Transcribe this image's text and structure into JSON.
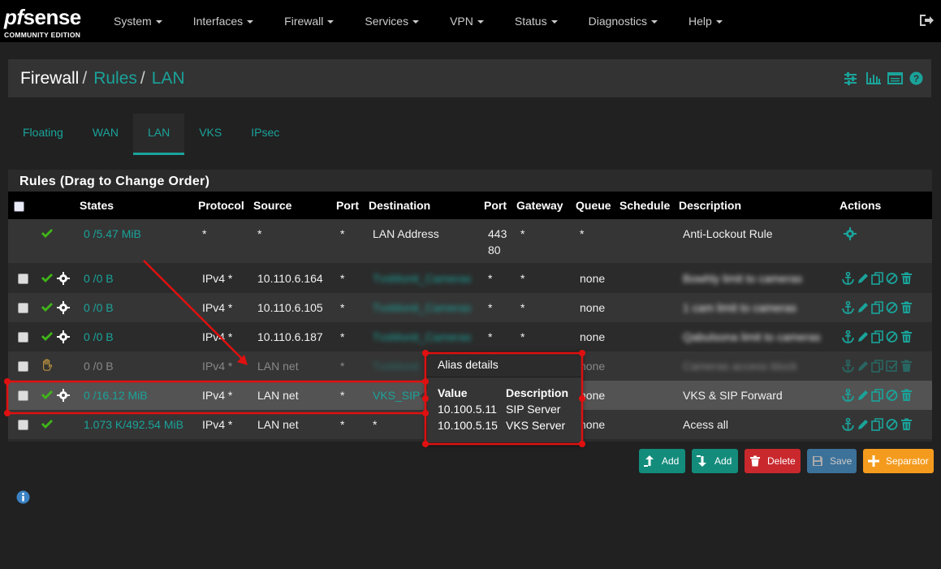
{
  "brand": {
    "name": "sense",
    "prefix": "pf",
    "edition": "COMMUNITY EDITION"
  },
  "nav": {
    "items": [
      "System",
      "Interfaces",
      "Firewall",
      "Services",
      "VPN",
      "Status",
      "Diagnostics",
      "Help"
    ]
  },
  "breadcrumb": {
    "root": "Firewall",
    "level1": "Rules",
    "level2": "LAN"
  },
  "tabs": [
    "Floating",
    "WAN",
    "LAN",
    "VKS",
    "IPsec"
  ],
  "active_tab": "LAN",
  "panel": {
    "title": "Rules (Drag to Change Order)"
  },
  "table": {
    "headers": {
      "states": "States",
      "protocol": "Protocol",
      "source": "Source",
      "port1": "Port",
      "destination": "Destination",
      "port2": "Port",
      "gateway": "Gateway",
      "queue": "Queue",
      "schedule": "Schedule",
      "description": "Description",
      "actions": "Actions"
    },
    "rows": [
      {
        "states": "0 /5.47 MiB",
        "protocol": "*",
        "source": "*",
        "port": "*",
        "destination": "LAN Address",
        "dport1": "443",
        "dport2": "80",
        "gateway": "*",
        "queue": "*",
        "description": "Anti-Lockout Rule"
      },
      {
        "states": "0 /0 B",
        "protocol": "IPv4 *",
        "source": "10.110.6.164",
        "port": "*",
        "destination": "TvsMonit_Cameras",
        "dport": "*",
        "gateway": "*",
        "queue": "none",
        "description": "Bowhly limit to cameras"
      },
      {
        "states": "0 /0 B",
        "protocol": "IPv4 *",
        "source": "10.110.6.105",
        "port": "*",
        "destination": "TvsMonit_Cameras",
        "dport": "*",
        "gateway": "*",
        "queue": "none",
        "description": "1 cam limit to cameras"
      },
      {
        "states": "0 /0 B",
        "protocol": "IPv4 *",
        "source": "10.110.6.187",
        "port": "*",
        "destination": "TvsMonit_Cameras",
        "dport": "*",
        "gateway": "*",
        "queue": "none",
        "description": "Qabulsona limit to cameras"
      },
      {
        "states": "0 /0 B",
        "protocol": "IPv4 *",
        "source": "LAN net",
        "port": "*",
        "destination": "TvsMonit",
        "dport": "",
        "gateway": "",
        "queue": "none",
        "description": "Cameras access block"
      },
      {
        "states": "0 /16.12 MiB",
        "protocol": "IPv4 *",
        "source": "LAN net",
        "port": "*",
        "destination": "VKS_SIP",
        "dport": "",
        "gateway": "",
        "queue": "none",
        "description": "VKS & SIP Forward"
      },
      {
        "states": "1.073 K/492.54 MiB",
        "protocol": "IPv4 *",
        "source": "LAN net",
        "port": "*",
        "destination": "*",
        "dport": "",
        "gateway": "",
        "queue": "none",
        "description": "Acess all"
      }
    ]
  },
  "popover": {
    "title": "Alias details",
    "col_value": "Value",
    "col_desc": "Description",
    "entries": [
      {
        "value": "10.100.5.11",
        "desc": "SIP Server"
      },
      {
        "value": "10.100.5.15",
        "desc": "VKS Server"
      }
    ]
  },
  "buttons": {
    "add_top": "Add",
    "add_bottom": "Add",
    "delete": "Delete",
    "save": "Save",
    "separator": "Separator"
  },
  "colors": {
    "accent": "#1aa39a",
    "green": "#3fb618",
    "annotation": "#e01010"
  }
}
